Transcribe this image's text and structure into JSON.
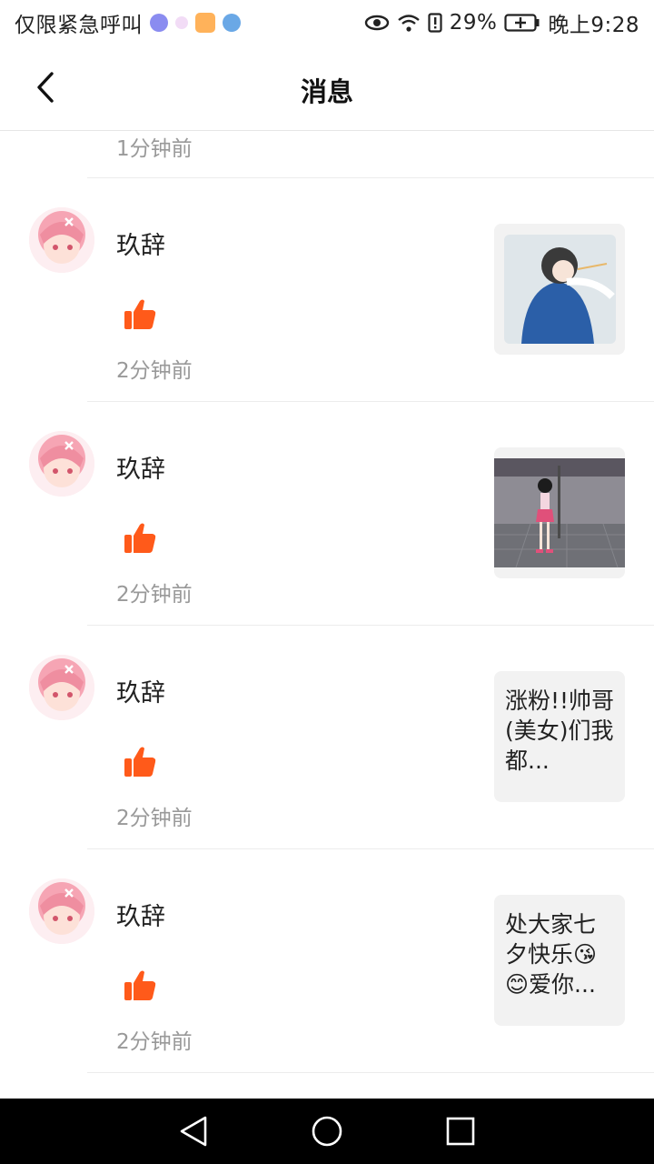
{
  "status_bar": {
    "carrier": "仅限紧急呼叫",
    "battery": "29%",
    "time": "晚上9:28"
  },
  "header": {
    "title": "消息"
  },
  "partial_item": {
    "time": "1分钟前"
  },
  "items": [
    {
      "name": "玖辞",
      "time": "2分钟前",
      "preview_type": "image",
      "preview_text": ""
    },
    {
      "name": "玖辞",
      "time": "2分钟前",
      "preview_type": "image",
      "preview_text": ""
    },
    {
      "name": "玖辞",
      "time": "2分钟前",
      "preview_type": "text",
      "preview_text": "涨粉!!帅哥(美女)们我都..."
    },
    {
      "name": "玖辞",
      "time": "2分钟前",
      "preview_type": "text",
      "preview_text": "处大家七夕快乐😘😊爱你..."
    }
  ],
  "colors": {
    "like": "#ff5a1a",
    "divider": "#ececec",
    "muted_text": "#999999"
  }
}
